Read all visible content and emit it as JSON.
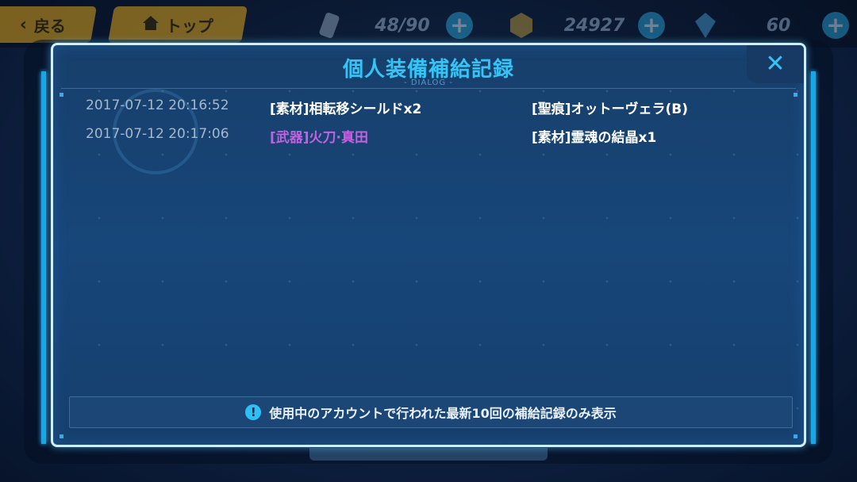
{
  "topbar": {
    "back_label": "戻る",
    "top_label": "トップ",
    "stamina": "48/90",
    "coins": "24927",
    "crystals": "60"
  },
  "dialog": {
    "title": "個人装備補給記録",
    "subtitle": "- DIALOG -",
    "close_symbol": "✕",
    "notice": "使用中のアカウントで行われた最新10回の補給記録のみ表示",
    "records": [
      {
        "timestamp": "2017-07-12  20:16:52",
        "item_a": "[素材]相転移シールドx2",
        "item_b": "[聖痕]オットーヴェラ(B)"
      },
      {
        "timestamp": "2017-07-12  20:17:06",
        "item_a": "[武器]火刀·真田",
        "item_b": "[素材]霊魂の結晶x1"
      }
    ]
  },
  "colors": {
    "accent": "#34c4f6",
    "weapon_text": "#c063e0",
    "timestamp_text": "#a5b8cc",
    "topbar_button": "#d9a21d"
  }
}
